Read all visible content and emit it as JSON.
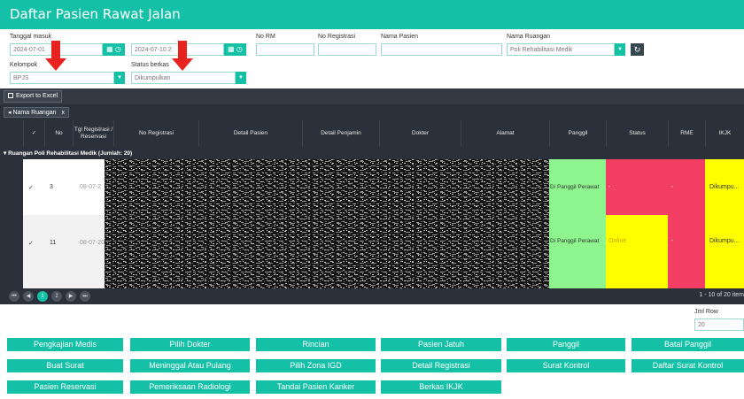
{
  "title": "Daftar Pasien Rawat Jalan",
  "filters": {
    "tanggal_masuk_label": "Tanggal masuk",
    "tgl_from": "2024-07-01",
    "tgl_from_tail": "0",
    "tgl_to": "2024-07-10 2",
    "no_rm_label": "No RM",
    "no_registrasi_label": "No Registrasi",
    "nama_pasien_label": "Nama Pasien",
    "nama_ruangan_label": "Nama Ruangan",
    "nama_ruangan_value": "Poli Rehabilitasi Medik",
    "kelompok_label": "Kelompok",
    "kelompok_value": "BPJS",
    "status_berkas_label": "Status berkas",
    "status_berkas_value": "Dikumpulkan"
  },
  "toolbar": {
    "export_label": "Export to Excel"
  },
  "group_chip": {
    "label": "Nama Ruangan",
    "close": "x"
  },
  "columns": {
    "check": "✓",
    "no": "No",
    "tgl": "Tgl Registrasi / Reservasi",
    "no_registrasi": "No Registrasi",
    "detail_pasien": "Detail Pasien",
    "detail_penjamin": "Detail Penjamin",
    "dokter": "Dokter",
    "alamat": "Alamat",
    "panggil": "Panggil",
    "status": "Status",
    "rme": "RME",
    "ikjk": "IKJK"
  },
  "group_row": "Ruangan Poli Rehabilitasi Medik (Jumlah: 20)",
  "rows": [
    {
      "check": "✓",
      "no": "3",
      "tgl": "08-07-2",
      "panggil": "Di Panggil Perawat",
      "status": "-",
      "rme": "-",
      "ikjk": "Dikumpu..."
    },
    {
      "check": "✓",
      "no": "11",
      "tgl": "08-07-20",
      "panggil": "Di Panggil Perawat",
      "status": "Online",
      "rme": "-",
      "ikjk": "Dikumpu..."
    }
  ],
  "colors": {
    "accent": "#14c1a6",
    "panggil_green": "#8ef58e",
    "status_red": "#f23e63",
    "status_yellow": "#ffff00",
    "arrow_red": "#e8231f"
  },
  "pager": {
    "first": "⏮",
    "prev": "◀",
    "page1": "1",
    "page2": "2",
    "next": "▶",
    "last": "⏭",
    "info": "1 - 10 of 20 item"
  },
  "jml_row": {
    "label": "Jml Row",
    "value": "20"
  },
  "buttons": [
    [
      "Pengkajian Medis",
      "Pilih Dokter",
      "Rincian",
      "Pasien Jatuh",
      "Panggil",
      "Batal Panggil"
    ],
    [
      "Buat Surat",
      "Meninggal Atau Pulang",
      "Pilih Zona IGD",
      "Detail Registrasi",
      "Surat Kontrol",
      "Daftar Surat Kontrol"
    ],
    [
      "Pasien Reservasi",
      "Pemeriksaan Radiologi",
      "Tandai Pasien Kanker",
      "Berkas IKJK"
    ]
  ]
}
